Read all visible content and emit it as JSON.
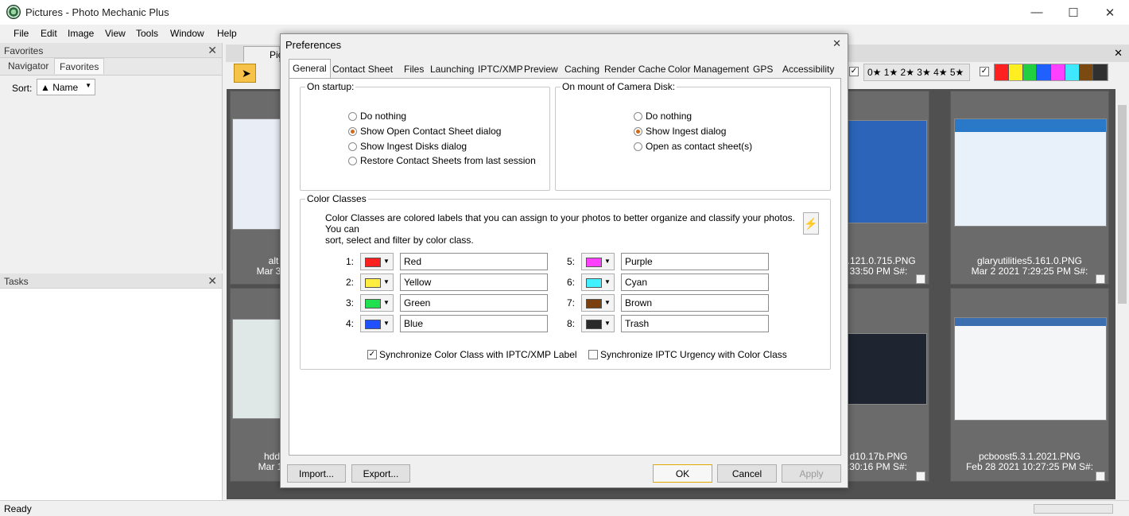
{
  "app": {
    "title": "Pictures - Photo Mechanic Plus",
    "minimize": "—",
    "maximize": "☐",
    "close": "✕"
  },
  "menu": [
    "File",
    "Edit",
    "Image",
    "View",
    "Tools",
    "Window",
    "Help"
  ],
  "left": {
    "favorites_header": "Favorites",
    "tabs": [
      "Navigator",
      "Favorites"
    ],
    "sort_label": "Sort:",
    "sort_value": "▲ Name",
    "tasks_header": "Tasks"
  },
  "toolbar": {
    "tab_label": "Pic",
    "stars": "0★ 1★ 2★ 3★ 4★ 5★",
    "palette": [
      "#ff2020",
      "#ffee20",
      "#20d040",
      "#2060ff",
      "#ff40ff",
      "#40e8ff",
      "#7a4a10",
      "#303030"
    ]
  },
  "thumbs": [
    {
      "name": "alt",
      "date": "Mar 3"
    },
    {
      "name": "..121.0.715.PNG",
      "date": "33:50 PM S#:"
    },
    {
      "name": "glaryutilities5.161.0.PNG",
      "date": "Mar 2 2021 7:29:25 PM S#:"
    },
    {
      "name": "hdd",
      "date": "Mar 1"
    },
    {
      "name": "d10.17b.PNG",
      "date": ":30:16 PM S#:"
    },
    {
      "name": "pcboost5.3.1.2021.PNG",
      "date": "Feb 28 2021 10:27:25 PM S#:"
    }
  ],
  "status": {
    "text": "Ready"
  },
  "dialog": {
    "title": "Preferences",
    "close": "✕",
    "tabs": [
      "General",
      "Contact Sheet",
      "Files",
      "Launching",
      "IPTC/XMP",
      "Preview",
      "Caching",
      "Render Cache",
      "Color Management",
      "GPS",
      "Accessibility"
    ],
    "startup": {
      "label": "On startup:",
      "options": [
        "Do nothing",
        "Show Open Contact Sheet dialog",
        "Show Ingest Disks dialog",
        "Restore Contact Sheets from last session"
      ],
      "selected": 1
    },
    "mount": {
      "label": "On mount of Camera Disk:",
      "options": [
        "Do nothing",
        "Show Ingest dialog",
        "Open as contact sheet(s)"
      ],
      "selected": 1
    },
    "color_classes": {
      "label": "Color Classes",
      "description_line1": "Color Classes are colored labels that you can assign to your photos to better organize and classify your photos.  You can",
      "description_line2": "sort, select and filter by color class.",
      "lightning": "⚡",
      "items": [
        {
          "num": "1:",
          "name": "Red",
          "color": "#ff2020"
        },
        {
          "num": "2:",
          "name": "Yellow",
          "color": "#ffee40"
        },
        {
          "num": "3:",
          "name": "Green",
          "color": "#20e050"
        },
        {
          "num": "4:",
          "name": "Blue",
          "color": "#2050ff"
        },
        {
          "num": "5:",
          "name": "Purple",
          "color": "#ff40ff"
        },
        {
          "num": "6:",
          "name": "Cyan",
          "color": "#40f0ff"
        },
        {
          "num": "7:",
          "name": "Brown",
          "color": "#7a4010"
        },
        {
          "num": "8:",
          "name": "Trash",
          "color": "#2a2a2a"
        }
      ],
      "sync_iptc_label": "Synchronize Color Class with IPTC/XMP Label",
      "sync_iptc_checked": true,
      "sync_urgency_label": "Synchronize IPTC Urgency with Color Class",
      "sync_urgency_checked": false
    },
    "buttons": {
      "import": "Import...",
      "export": "Export...",
      "ok": "OK",
      "cancel": "Cancel",
      "apply": "Apply"
    }
  }
}
